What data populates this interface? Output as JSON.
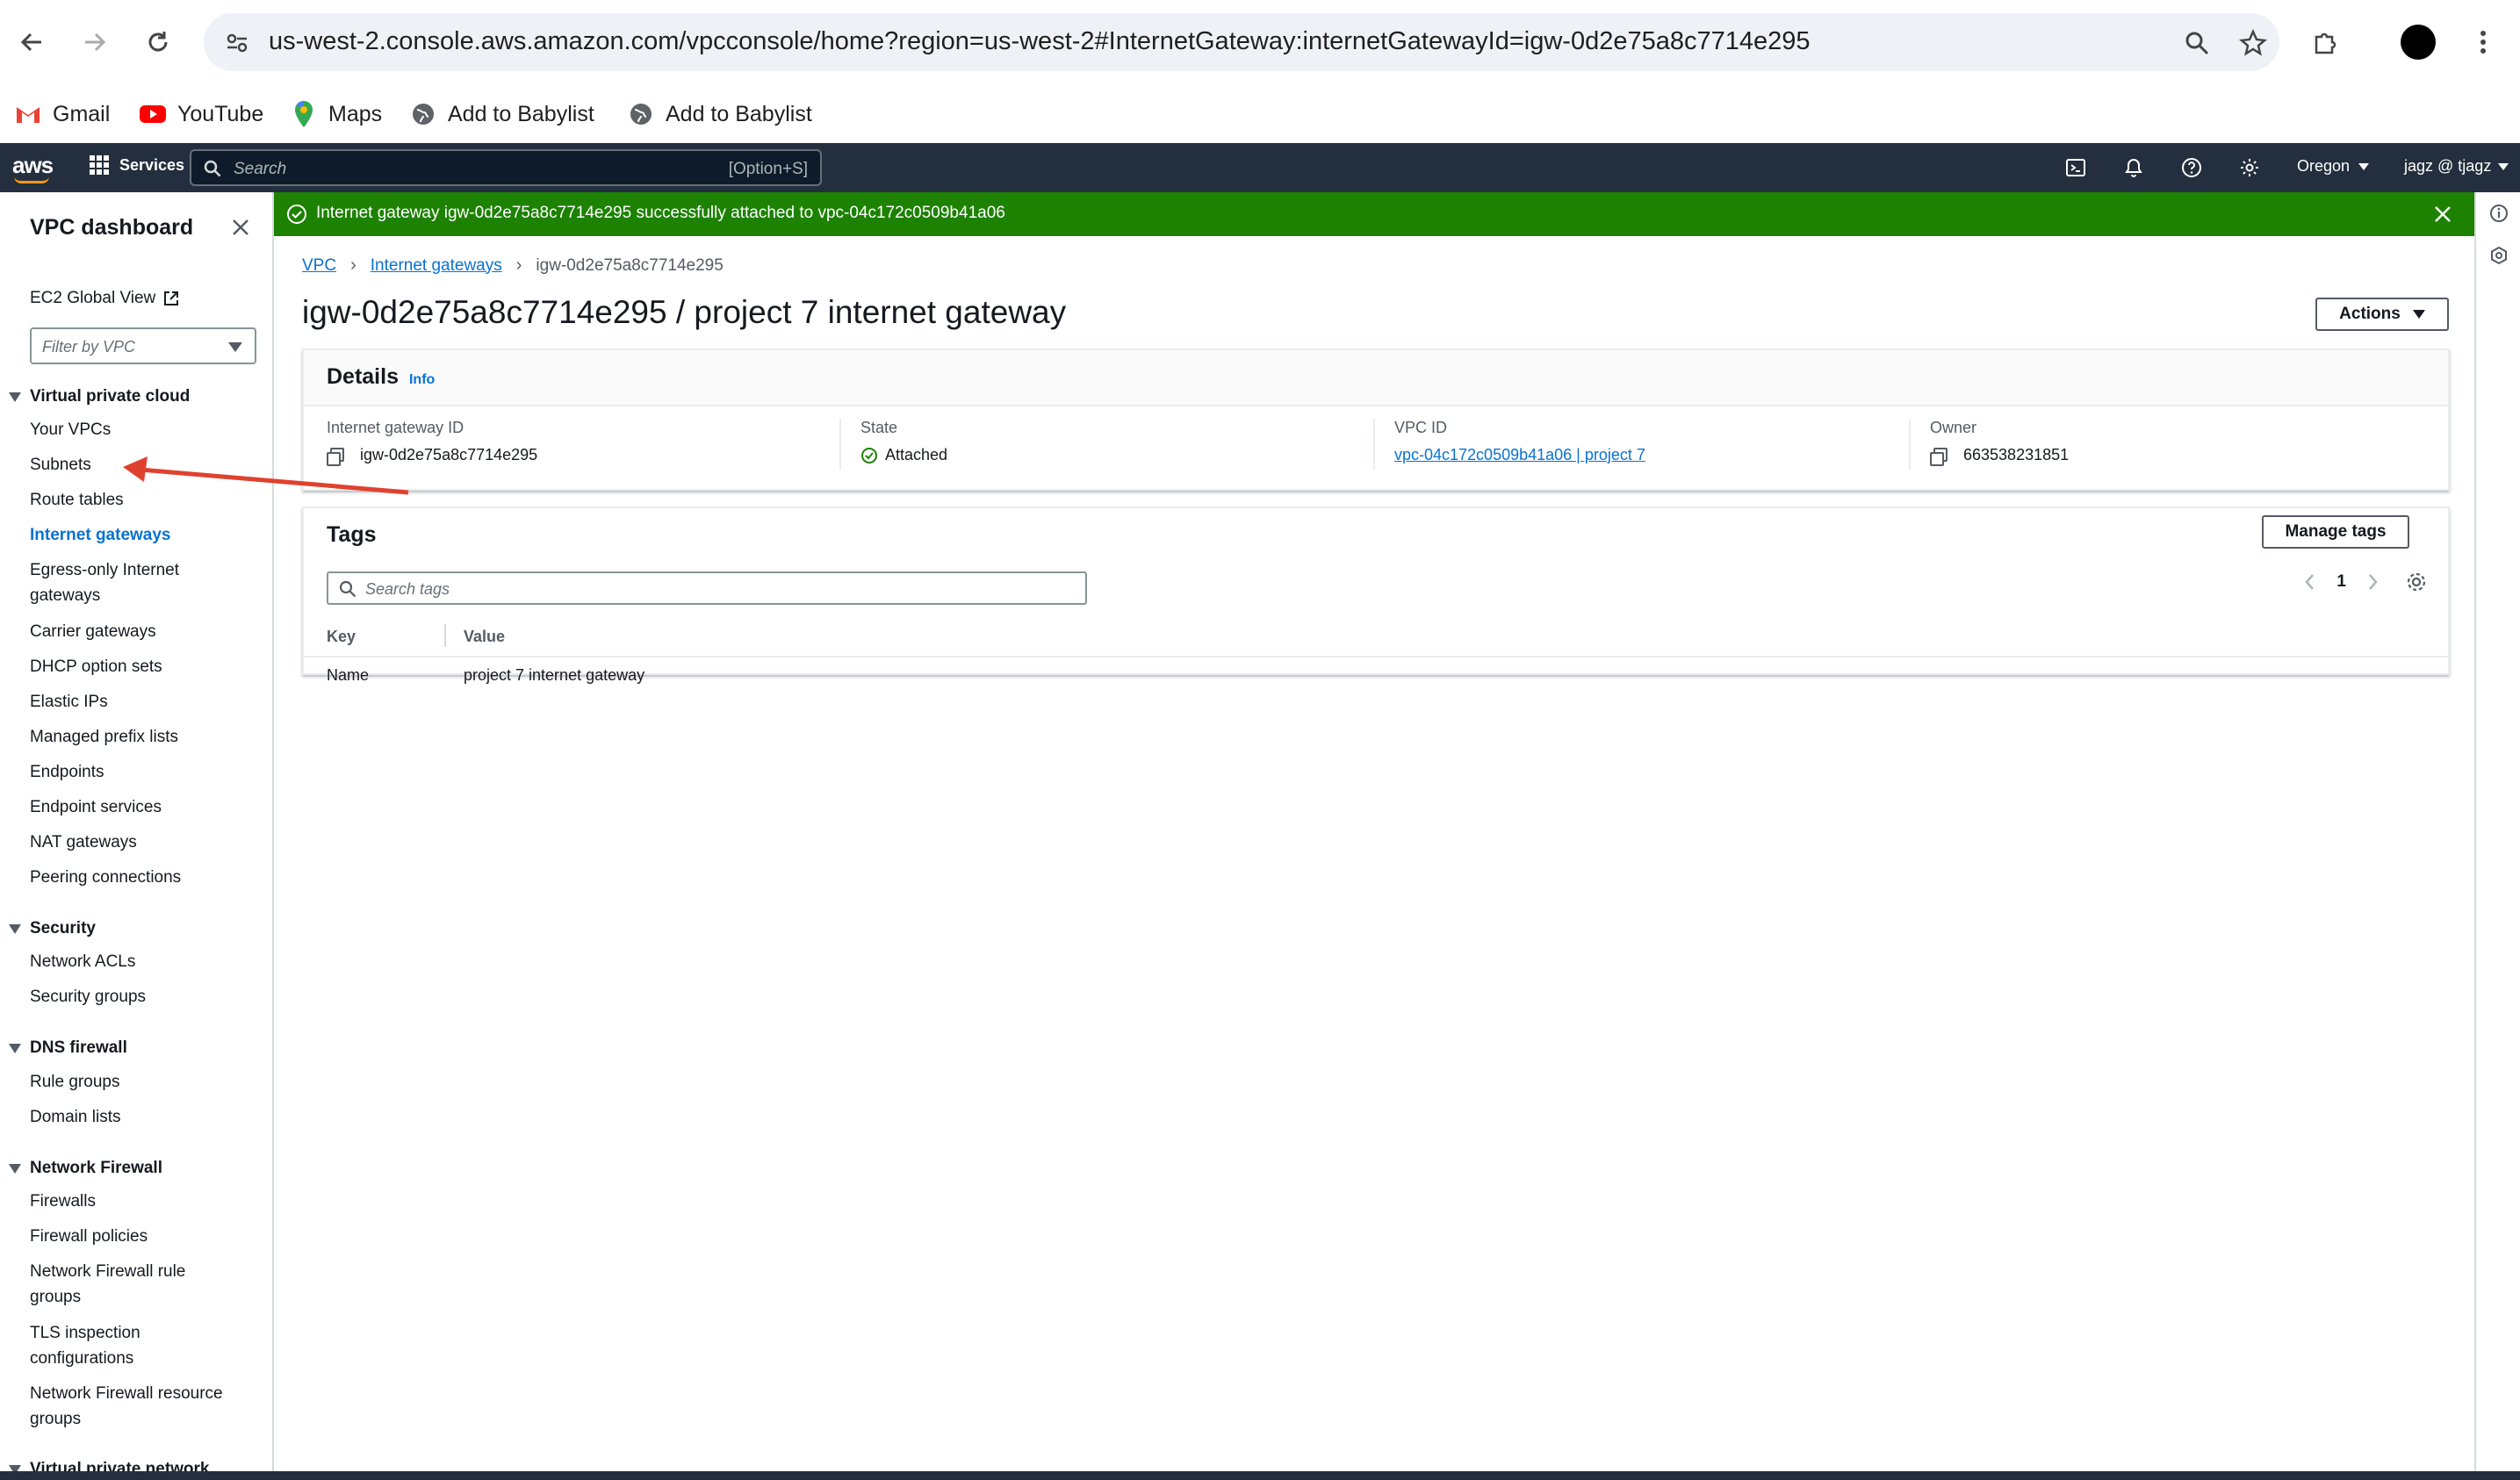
{
  "browser": {
    "url": "us-west-2.console.aws.amazon.com/vpcconsole/home?region=us-west-2#InternetGateway:internetGatewayId=igw-0d2e75a8c7714e295",
    "bookmarks": [
      "Gmail",
      "YouTube",
      "Maps",
      "Add to Babylist",
      "Add to Babylist"
    ]
  },
  "aws_nav": {
    "logo": "aws",
    "services": "Services",
    "search_placeholder": "Search",
    "search_shortcut": "[Option+S]",
    "region": "Oregon",
    "user": "jagz @ tjagz"
  },
  "sidebar": {
    "title": "VPC dashboard",
    "ec2_global_view": "EC2 Global View",
    "filter_placeholder": "Filter by VPC",
    "sections": [
      {
        "title": "Virtual private cloud",
        "items": [
          "Your VPCs",
          "Subnets",
          "Route tables",
          "Internet gateways",
          "Egress-only Internet gateways",
          "Carrier gateways",
          "DHCP option sets",
          "Elastic IPs",
          "Managed prefix lists",
          "Endpoints",
          "Endpoint services",
          "NAT gateways",
          "Peering connections"
        ]
      },
      {
        "title": "Security",
        "items": [
          "Network ACLs",
          "Security groups"
        ]
      },
      {
        "title": "DNS firewall",
        "items": [
          "Rule groups",
          "Domain lists"
        ]
      },
      {
        "title": "Network Firewall",
        "items": [
          "Firewalls",
          "Firewall policies",
          "Network Firewall rule groups",
          "TLS inspection configurations",
          "Network Firewall resource groups"
        ]
      },
      {
        "title": "Virtual private network",
        "items": []
      }
    ],
    "active_item": "Internet gateways"
  },
  "flash": {
    "message": "Internet gateway igw-0d2e75a8c7714e295 successfully attached to vpc-04c172c0509b41a06",
    "color": "#1d8102"
  },
  "breadcrumb": [
    "VPC",
    "Internet gateways",
    "igw-0d2e75a8c7714e295"
  ],
  "page": {
    "title": "igw-0d2e75a8c7714e295 / project 7 internet gateway",
    "actions_label": "Actions"
  },
  "details": {
    "title": "Details",
    "info": "Info",
    "fields": [
      {
        "label": "Internet gateway ID",
        "value": "igw-0d2e75a8c7714e295"
      },
      {
        "label": "State",
        "value": "Attached"
      },
      {
        "label": "VPC ID",
        "value": "vpc-04c172c0509b41a06 | project 7"
      },
      {
        "label": "Owner",
        "value": "663538231851"
      }
    ]
  },
  "tags": {
    "title": "Tags",
    "manage_label": "Manage tags",
    "search_placeholder": "Search tags",
    "page": "1",
    "columns": [
      "Key",
      "Value"
    ],
    "rows": [
      {
        "key": "Name",
        "value": "project 7 internet gateway"
      }
    ]
  }
}
